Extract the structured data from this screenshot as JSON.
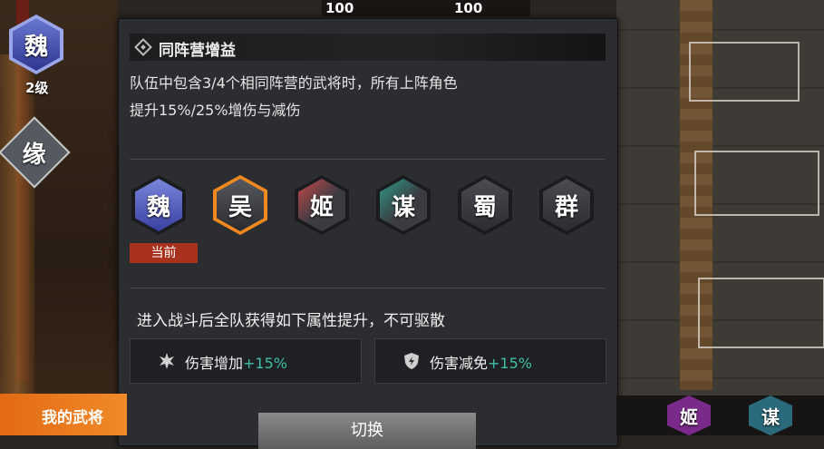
{
  "hud": {
    "hp_left": "100",
    "hp_right": "100"
  },
  "sidebar": {
    "faction_glyph": "魏",
    "level": "2级",
    "bond_glyph": "缘"
  },
  "panel": {
    "title": "同阵营增益",
    "description_line1": "队伍中包含3/4个相同阵营的武将时，所有上阵角色",
    "description_line2": "提升15%/25%增伤与减伤",
    "factions": [
      {
        "glyph": "魏",
        "color": "#4a56b8",
        "selected": false
      },
      {
        "glyph": "吴",
        "color": "#d06a18",
        "selected": true
      },
      {
        "glyph": "姬",
        "color": "#b23a3a",
        "selected": false
      },
      {
        "glyph": "谋",
        "color": "#2f8a7a",
        "selected": false
      },
      {
        "glyph": "蜀",
        "color": "#c8a060",
        "selected": false
      },
      {
        "glyph": "群",
        "color": "#9a9aa0",
        "selected": false
      }
    ],
    "current_tag": "当前",
    "bonus_title": "进入战斗后全队获得如下属性提升，不可驱散",
    "stats": [
      {
        "label": "伤害增加",
        "value": "+15%",
        "icon": "damage-up-icon"
      },
      {
        "label": "伤害减免",
        "value": "+15%",
        "icon": "shield-icon"
      }
    ],
    "switch_button": "切换"
  },
  "bottom": {
    "tab_label": "我的武将",
    "right_badges": [
      "姬",
      "谋"
    ]
  },
  "colors": {
    "accent_green": "#3fc0a8",
    "tag_red": "#a8321e",
    "tab_orange": "#e26a14"
  }
}
